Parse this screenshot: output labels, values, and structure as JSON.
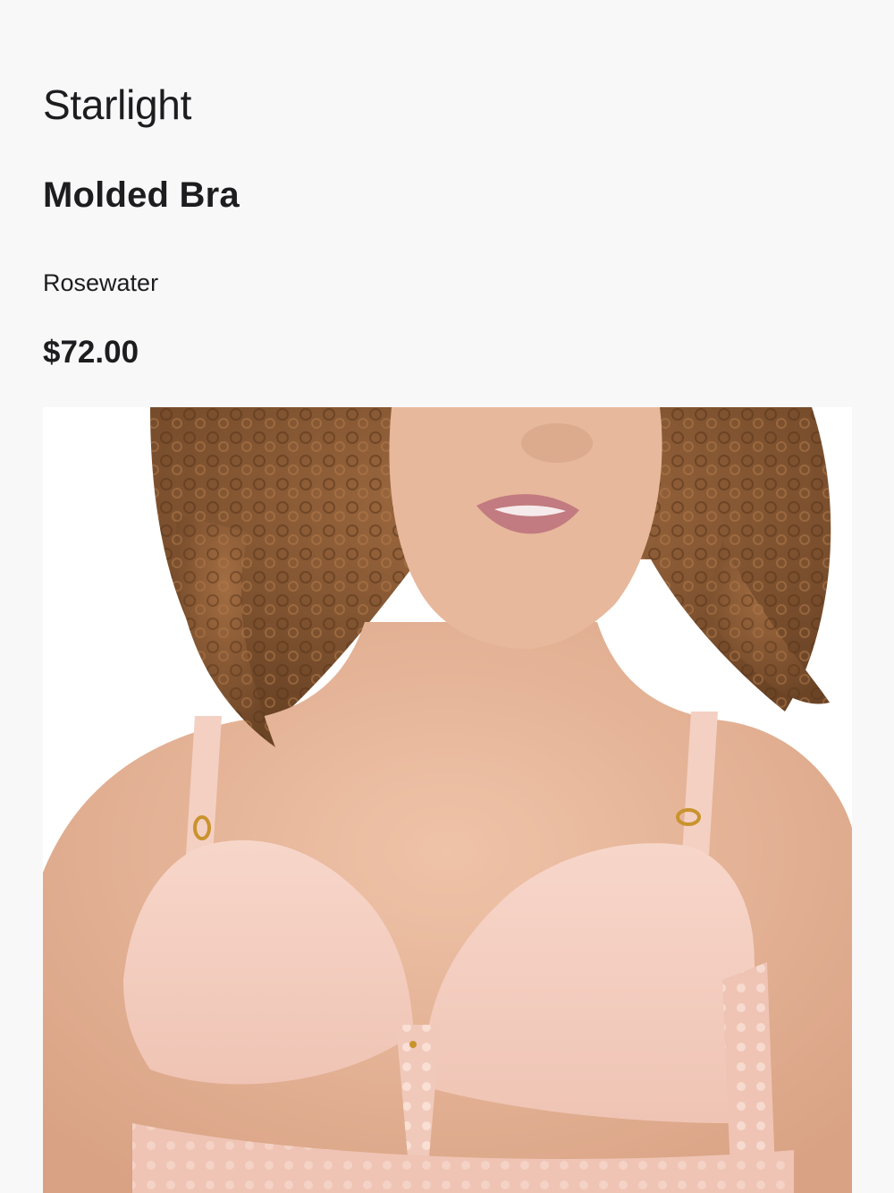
{
  "product": {
    "brand": "Starlight",
    "name": "Molded Bra",
    "color": "Rosewater",
    "price": "$72.00"
  },
  "image": {
    "alt": "Model wearing Starlight molded bra in Rosewater",
    "colors": {
      "background": "#ffffff",
      "hair": "#8a5a34",
      "skin": "#e4b49a",
      "bra": "#f4cdbf",
      "lips": "#c27b80"
    }
  }
}
